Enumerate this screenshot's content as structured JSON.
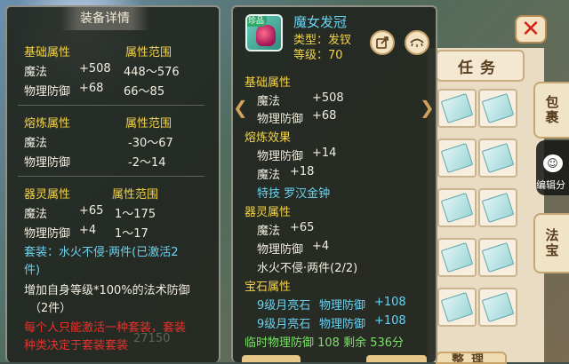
{
  "background": {
    "tab_task": "任务",
    "side_tabs": [
      "包裹",
      "法宝"
    ],
    "edit_score_label": "编辑分",
    "bottom_right_button": "整理",
    "faded_score": "27150"
  },
  "detail_panel": {
    "title": "装备详情",
    "base": {
      "header_attr": "基础属性",
      "header_range": "属性范围",
      "rows": [
        {
          "name": "魔法",
          "value": "+508",
          "range": "448～576"
        },
        {
          "name": "物理防御",
          "value": "+68",
          "range": "66～85"
        }
      ]
    },
    "refine": {
      "header_attr": "熔炼属性",
      "header_range": "属性范围",
      "rows": [
        {
          "name": "魔法",
          "value": "",
          "range": "-30～67"
        },
        {
          "name": "物理防御",
          "value": "",
          "range": "-2～14"
        }
      ]
    },
    "spirit": {
      "header_attr": "器灵属性",
      "header_range": "属性范围",
      "rows": [
        {
          "name": "魔法",
          "value": "+65",
          "range": "1～175"
        },
        {
          "name": "物理防御",
          "value": "+4",
          "range": "1～17"
        }
      ]
    },
    "set_line1": "套装：水火不侵·两件(已激活2",
    "set_line2": "件)",
    "effect_line1": "增加自身等级*100%的法术防御",
    "effect_line2": "（2件）",
    "warning_line1": "每个人只能激活一种套装，套装",
    "warning_line2": "种类决定于套装套装"
  },
  "item_panel": {
    "name": "魔女发冠",
    "type": "类型：发钗",
    "level": "等级：70",
    "badge": "珍品",
    "base_header": "基础属性",
    "base_rows": [
      {
        "name": "魔法",
        "value": "+508"
      },
      {
        "name": "物理防御",
        "value": "+68"
      }
    ],
    "refine_header": "熔炼效果",
    "refine_rows": [
      {
        "name": "物理防御",
        "value": "+14"
      },
      {
        "name": "魔法",
        "value": "+18"
      }
    ],
    "stunt": "特技  罗汉金钟",
    "spirit_header": "器灵属性",
    "spirit_rows": [
      {
        "name": "魔法",
        "value": "+65"
      },
      {
        "name": "物理防御",
        "value": "+4"
      }
    ],
    "set_line": "水火不侵·两件(2/2)",
    "gem_header": "宝石属性",
    "gem_rows": [
      {
        "gem": "9级月亮石",
        "name": "物理防御",
        "value": "+108"
      },
      {
        "gem": "9级月亮石",
        "name": "物理防御",
        "value": "+108"
      }
    ],
    "temp_line": "临时物理防御  108  剩余  536分"
  },
  "colors": {
    "header_yellow": "#f2d24a",
    "cyan": "#6bd2f0",
    "green": "#7de06a",
    "red": "#e8322a"
  },
  "icons": [
    "close-icon",
    "share-icon",
    "eye-icon",
    "arrow-left-icon",
    "arrow-right-icon"
  ]
}
